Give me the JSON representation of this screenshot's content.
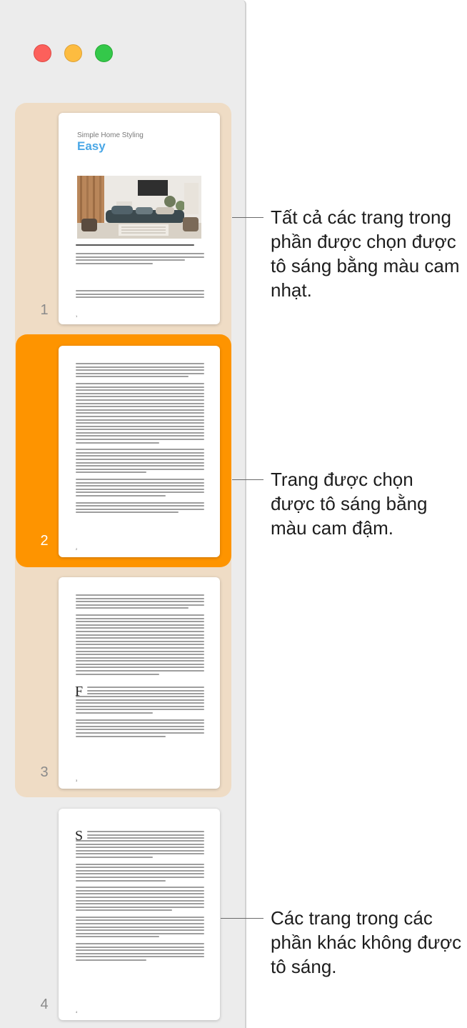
{
  "window": {
    "controls": [
      "close",
      "minimize",
      "zoom"
    ]
  },
  "colors": {
    "section_highlight": "#efdcc5",
    "selected_highlight": "#fe9400",
    "sidebar_bg": "#ececec"
  },
  "pages": [
    {
      "number": "1",
      "subtitle": "Simple Home Styling",
      "title": "Easy",
      "caption": "Lorem ipsum dolor sit amet, ligula suspendisse nulla pretium, rhoncus tempor fermentum.",
      "footer": "1"
    },
    {
      "number": "2",
      "footer": "2"
    },
    {
      "number": "3",
      "dropcap": "F",
      "footer": "3"
    },
    {
      "number": "4",
      "dropcap": "S",
      "footer": "4"
    }
  ],
  "callouts": [
    {
      "text": "Tất cả các trang trong phần được chọn được tô sáng bằng màu cam nhạt."
    },
    {
      "text": "Trang được chọn được tô sáng bằng màu cam đậm."
    },
    {
      "text": "Các trang trong các phần khác không được tô sáng."
    }
  ]
}
